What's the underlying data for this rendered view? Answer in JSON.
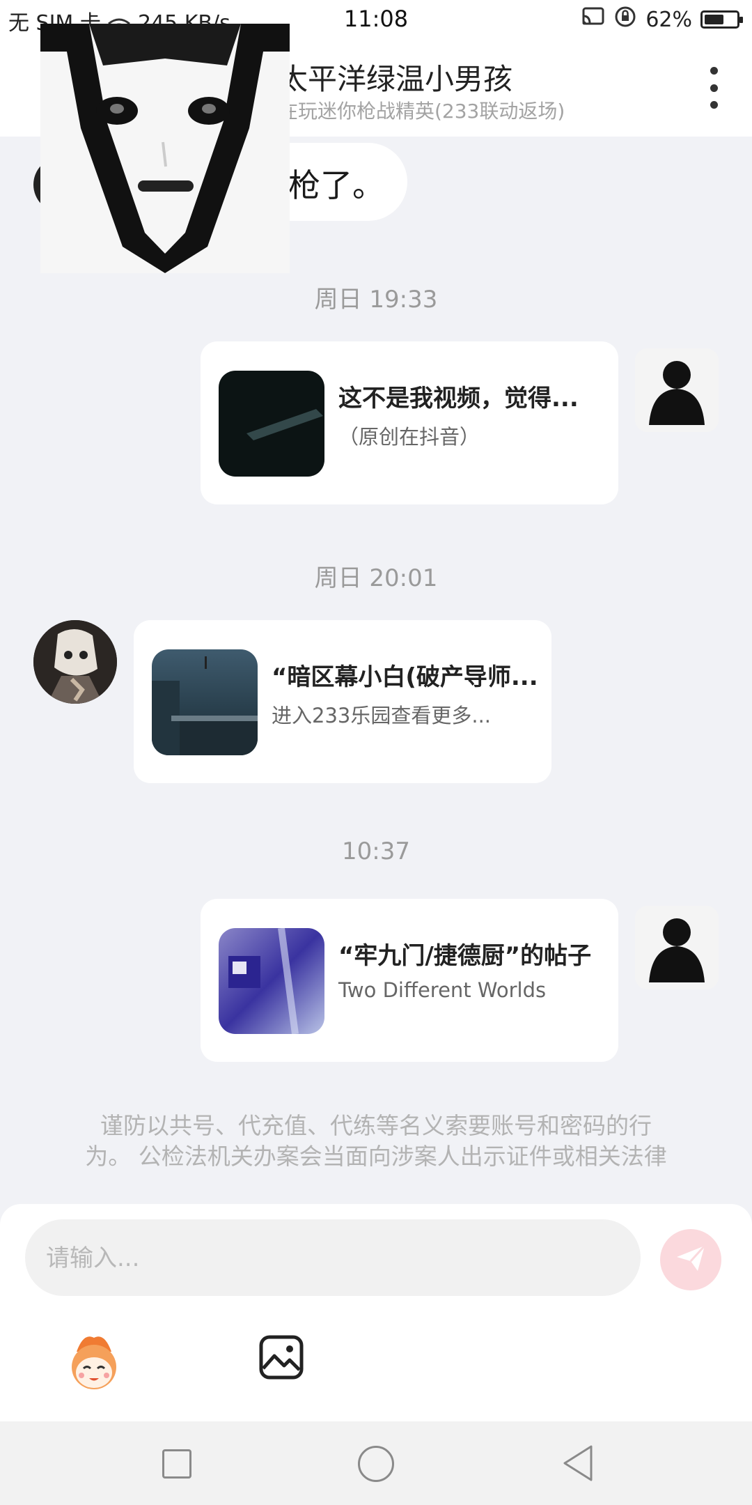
{
  "status_bar": {
    "carrier": "无 SIM 卡",
    "speed": "245 KB/s",
    "time": "11:08",
    "battery_percent": "62%",
    "battery_level": 0.62
  },
  "header": {
    "title": "太平洋绿温小男孩",
    "subtitle": "在玩迷你枪战精英(233联动返场)"
  },
  "messages": {
    "top_fragment": "枪了。",
    "time_1": "周日 19:33",
    "card_1": {
      "title": "这不是我视频，觉得...",
      "desc": "（原创在抖音）"
    },
    "time_2": "周日 20:01",
    "card_2": {
      "title": "“暗区幕小白(破产导师...",
      "desc": "进入233乐园查看更多..."
    },
    "time_3": "10:37",
    "card_3": {
      "title": "“牢九门/捷德厨”的帖子",
      "desc": "Two Different Worlds"
    }
  },
  "notice": {
    "line1": "谨防以共号、代充值、代练等名义索要账号和密码的行",
    "line2": "为。 公检法机关办案会当面向涉案人出示证件或相关法律"
  },
  "input": {
    "placeholder": "请输入..."
  },
  "colors": {
    "background": "#f1f2f6",
    "send_button": "#fbd9dd",
    "timestamp": "#9a9a9a"
  }
}
